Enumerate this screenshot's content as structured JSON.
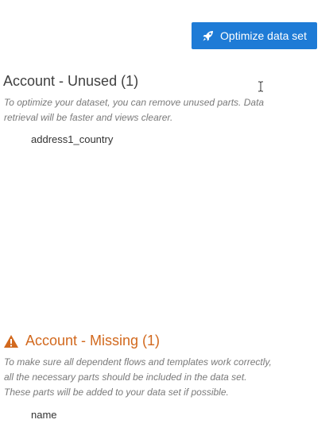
{
  "toolbar": {
    "optimize_label": "Optimize data set",
    "optimize_icon": "rocket-icon",
    "accent_color": "#1e7bd6"
  },
  "unused_section": {
    "title": "Account - Unused (1)",
    "description_lines": [
      "To optimize your dataset, you can remove unused parts. Data",
      "retrieval will be faster and views clearer."
    ],
    "items": [
      "address1_country"
    ]
  },
  "missing_section": {
    "title": "Account - Missing (1)",
    "icon": "warning-icon",
    "title_color": "#d2691e",
    "description_lines": [
      "To make sure all dependent flows and templates work correctly,",
      "all the necessary parts should be included in the data set.",
      "These parts will be added to your data set if possible."
    ],
    "items": [
      "name"
    ]
  }
}
